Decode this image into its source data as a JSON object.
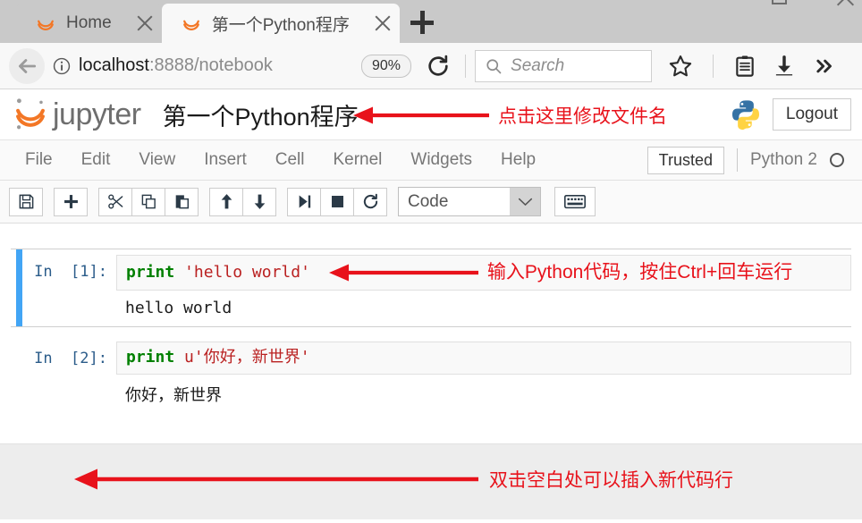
{
  "browser": {
    "tabs": [
      {
        "title": "Home",
        "favicon": "jupyter-favicon",
        "active": false
      },
      {
        "title": "第一个Python程序",
        "favicon": "jupyter-favicon",
        "active": true
      }
    ],
    "new_tab_label": "+",
    "url": {
      "host": "localhost",
      "rest": ":8888/notebook"
    },
    "zoom_level": "90%",
    "search_placeholder": "Search",
    "icons": {
      "back": "back-arrow-icon",
      "info": "info-circle-icon",
      "reload": "reload-icon",
      "search": "search-icon",
      "bookmark": "star-icon",
      "library": "library-icon",
      "downloads": "download-icon",
      "overflow": "chevron-double-right-icon",
      "menu": "hamburger-menu-icon"
    }
  },
  "jupyter": {
    "logo_text": "jupyter",
    "notebook_title": "第一个Python程序",
    "logout_label": "Logout",
    "kernel_logo": "python-logo",
    "menu": [
      "File",
      "Edit",
      "View",
      "Insert",
      "Cell",
      "Kernel",
      "Widgets",
      "Help"
    ],
    "trusted_label": "Trusted",
    "kernel_name": "Python 2",
    "toolbar": {
      "groups": [
        [
          {
            "name": "save-button",
            "icon": "save-icon"
          }
        ],
        [
          {
            "name": "insert-cell-below-button",
            "icon": "plus-icon"
          }
        ],
        [
          {
            "name": "cut-cell-button",
            "icon": "scissors-icon"
          },
          {
            "name": "copy-cell-button",
            "icon": "copy-icon"
          },
          {
            "name": "paste-cell-button",
            "icon": "paste-icon"
          }
        ],
        [
          {
            "name": "move-cell-up-button",
            "icon": "arrow-up-icon"
          },
          {
            "name": "move-cell-down-button",
            "icon": "arrow-down-icon"
          }
        ],
        [
          {
            "name": "run-cell-button",
            "icon": "run-icon"
          },
          {
            "name": "interrupt-kernel-button",
            "icon": "stop-square-icon"
          },
          {
            "name": "restart-kernel-button",
            "icon": "restart-icon"
          }
        ]
      ],
      "cell_type": "Code",
      "command_palette_icon": "keyboard-icon"
    },
    "cells": [
      {
        "prompt": "In  [1]:",
        "code_keyword": "print",
        "code_string": "'hello world'",
        "output": "hello world",
        "selected": true
      },
      {
        "prompt": "In  [2]:",
        "code_keyword": "print",
        "code_prefix": "u",
        "code_string": "'你好，新世界'",
        "output": "你好，新世界",
        "selected": false
      }
    ]
  },
  "annotations": {
    "color": "#e8121b",
    "header": "点击这里修改文件名",
    "cell_input": "输入Python代码，按住Ctrl+回车运行",
    "empty_area": "双击空白处可以插入新代码行"
  }
}
